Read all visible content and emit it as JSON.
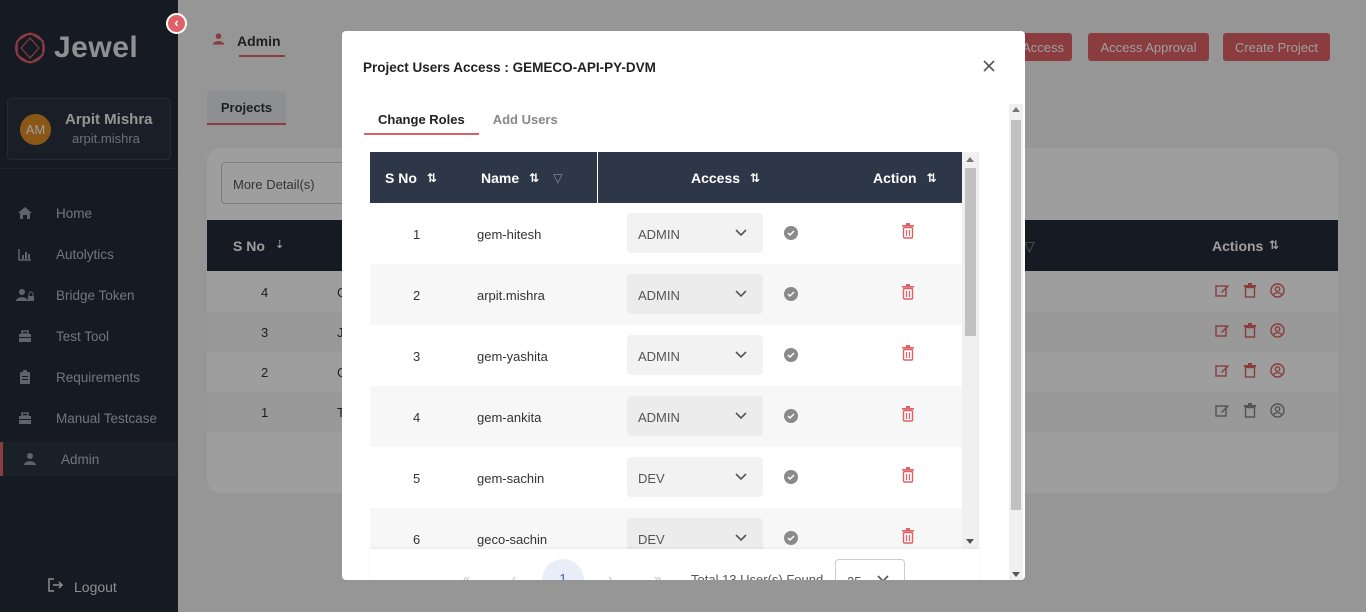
{
  "sidebar": {
    "logo_text": "Jewel",
    "profile": {
      "initials": "AM",
      "name": "Arpit Mishra",
      "username": "arpit.mishra"
    },
    "nav": [
      {
        "label": "Home",
        "icon": "home-icon"
      },
      {
        "label": "Autolytics",
        "icon": "chart-icon"
      },
      {
        "label": "Bridge Token",
        "icon": "user-lock-icon"
      },
      {
        "label": "Test Tool",
        "icon": "toolbox-icon"
      },
      {
        "label": "Requirements",
        "icon": "clipboard-icon"
      },
      {
        "label": "Manual Testcase",
        "icon": "toolbox-icon"
      },
      {
        "label": "Admin",
        "icon": "user-icon",
        "active": true
      }
    ],
    "logout_label": "Logout"
  },
  "header": {
    "admin_tab": "Admin",
    "buttons": [
      "Access",
      "Access Approval",
      "Create Project"
    ]
  },
  "projects": {
    "tab_label": "Projects",
    "more_details": "More Detail(s)",
    "headers": {
      "sno": "S No",
      "actions": "Actions"
    },
    "rows": [
      {
        "sno": "4",
        "initial": "G"
      },
      {
        "sno": "3",
        "initial": "J"
      },
      {
        "sno": "2",
        "initial": "G"
      },
      {
        "sno": "1",
        "initial": "T"
      }
    ]
  },
  "modal": {
    "title": "Project Users Access : GEMECO-API-PY-DVM",
    "tabs": [
      "Change Roles",
      "Add Users"
    ],
    "headers": {
      "sno": "S No",
      "name": "Name",
      "access": "Access",
      "action": "Action"
    },
    "rows": [
      {
        "sno": "1",
        "name": "gem-hitesh",
        "access": "ADMIN"
      },
      {
        "sno": "2",
        "name": "arpit.mishra",
        "access": "ADMIN"
      },
      {
        "sno": "3",
        "name": "gem-yashita",
        "access": "ADMIN"
      },
      {
        "sno": "4",
        "name": "gem-ankita",
        "access": "ADMIN"
      },
      {
        "sno": "5",
        "name": "gem-sachin",
        "access": "DEV"
      },
      {
        "sno": "6",
        "name": "geco-sachin",
        "access": "DEV"
      }
    ],
    "pager": {
      "first": "«",
      "prev": "‹",
      "current": "1",
      "next": "›",
      "last": "»",
      "total": "Total 13 User(s) Found",
      "per_page": "25"
    }
  },
  "colors": {
    "accent": "#df6167",
    "sidebar": "#242b38",
    "table_header": "#2e3748"
  }
}
